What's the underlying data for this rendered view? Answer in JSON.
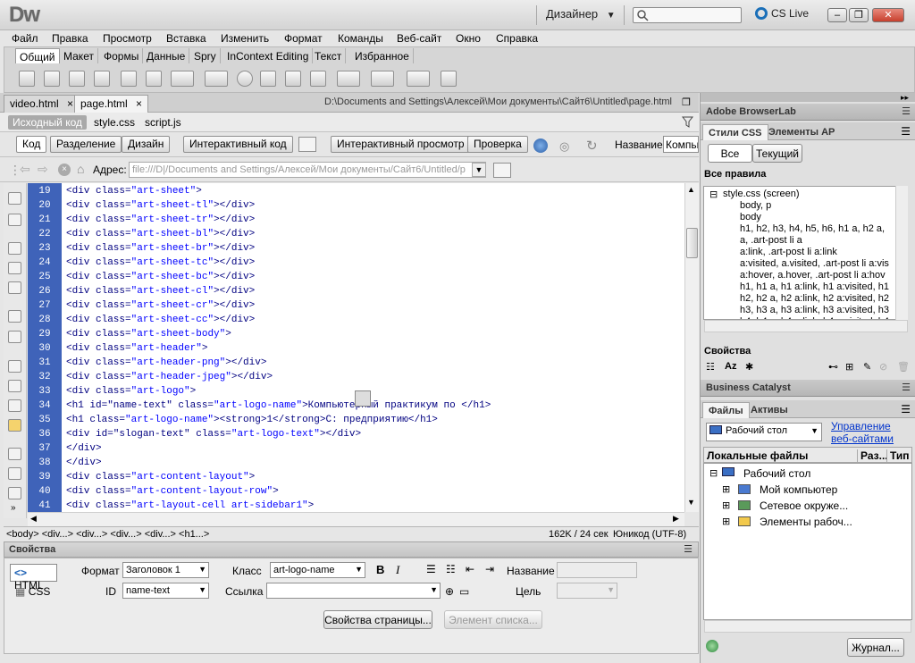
{
  "app": {
    "logo": "Dw",
    "workspace": "Дизайнер",
    "cslive": "CS Live",
    "close_label": "✕"
  },
  "menu": [
    "Файл",
    "Правка",
    "Просмотр",
    "Вставка",
    "Изменить",
    "Формат",
    "Команды",
    "Веб-сайт",
    "Окно",
    "Справка"
  ],
  "insert_tabs": [
    "Общий",
    "Макет",
    "Формы",
    "Данные",
    "Spry",
    "InContext Editing",
    "Текст",
    "Избранное"
  ],
  "doc_tabs": [
    "video.html",
    "page.html"
  ],
  "doc_path": "D:\\Documents and Settings\\Алексей\\Мои документы\\Сайт6\\Untitled\\page.html",
  "related_files": [
    "Исходный код",
    "style.css",
    "script.js"
  ],
  "doc_toolbar": {
    "code": "Код",
    "split": "Разделение",
    "design": "Дизайн",
    "live_code": "Интерактивный код",
    "live_view": "Интерактивный просмотр",
    "check": "Проверка",
    "title_label": "Название:",
    "title_value": "Компьют"
  },
  "address": {
    "label": "Адрес:",
    "value": "file:///D|/Documents and Settings/Алексей/Мои документы/Сайт6/Untitled/p"
  },
  "code_lines": [
    {
      "n": "19",
      "pre": "<div class=",
      "val": "\"art-sheet\"",
      "post": ">"
    },
    {
      "n": "20",
      "pre": "<div class=",
      "val": "\"art-sheet-tl\"",
      "post": "></div>"
    },
    {
      "n": "21",
      "pre": "<div class=",
      "val": "\"art-sheet-tr\"",
      "post": "></div>"
    },
    {
      "n": "22",
      "pre": "<div class=",
      "val": "\"art-sheet-bl\"",
      "post": "></div>"
    },
    {
      "n": "23",
      "pre": "<div class=",
      "val": "\"art-sheet-br\"",
      "post": "></div>"
    },
    {
      "n": "24",
      "pre": "<div class=",
      "val": "\"art-sheet-tc\"",
      "post": "></div>"
    },
    {
      "n": "25",
      "pre": "<div class=",
      "val": "\"art-sheet-bc\"",
      "post": "></div>"
    },
    {
      "n": "26",
      "pre": "<div class=",
      "val": "\"art-sheet-cl\"",
      "post": "></div>"
    },
    {
      "n": "27",
      "pre": "<div class=",
      "val": "\"art-sheet-cr\"",
      "post": "></div>"
    },
    {
      "n": "28",
      "pre": "<div class=",
      "val": "\"art-sheet-cc\"",
      "post": "></div>"
    },
    {
      "n": "29",
      "pre": "<div class=",
      "val": "\"art-sheet-body\"",
      "post": ">"
    },
    {
      "n": "30",
      "pre": "<div class=",
      "val": "\"art-header\"",
      "post": ">"
    },
    {
      "n": "31",
      "pre": "<div class=",
      "val": "\"art-header-png\"",
      "post": "></div>"
    },
    {
      "n": "32",
      "pre": "<div class=",
      "val": "\"art-header-jpeg\"",
      "post": "></div>"
    },
    {
      "n": "33",
      "pre": "<div class=",
      "val": "\"art-logo\"",
      "post": ">"
    },
    {
      "n": "34",
      "pre": "<h1 id=\"name-text\" class=",
      "val": "\"art-logo-name\"",
      "post": ">Компьютерный практикум по </h1>"
    },
    {
      "n": "35",
      "pre": "<h1 class=",
      "val": "\"art-logo-name\"",
      "post": "><strong>1</strong>С: предприятию</h1>"
    },
    {
      "n": "36",
      "pre": "<div id=\"slogan-text\" class=",
      "val": "\"art-logo-text\"",
      "post": "></div>"
    },
    {
      "n": "37",
      "pre": "</div>",
      "val": "",
      "post": ""
    },
    {
      "n": "38",
      "pre": "</div>",
      "val": "",
      "post": ""
    },
    {
      "n": "39",
      "pre": "<div class=",
      "val": "\"art-content-layout\"",
      "post": ">"
    },
    {
      "n": "40",
      "pre": "<div class=",
      "val": "\"art-content-layout-row\"",
      "post": ">"
    },
    {
      "n": "41",
      "pre": "<div class=",
      "val": "\"art-layout-cell art-sidebar1\"",
      "post": ">"
    }
  ],
  "status": {
    "tags": "<body> <div...> <div...> <div...> <div...> <h1...>",
    "size": "162K / 24 сек",
    "encoding": "Юникод (UTF-8)"
  },
  "properties": {
    "title": "Свойства",
    "html_btn": "HTML",
    "css_btn": "CSS",
    "format_label": "Формат",
    "format_value": "Заголовок 1",
    "class_label": "Класс",
    "class_value": "art-logo-name",
    "id_label": "ID",
    "id_value": "name-text",
    "link_label": "Ссылка",
    "link_value": "",
    "name_label": "Название",
    "target_label": "Цель",
    "page_props": "Свойства страницы...",
    "list_item": "Элемент списка..."
  },
  "right": {
    "browserlab": "Adobe BrowserLab",
    "css_tabs": [
      "Стили CSS",
      "Элементы AP"
    ],
    "css_modes": [
      "Все",
      "Текущий"
    ],
    "all_rules": "Все правила",
    "rules_root": "style.css (screen)",
    "rules": [
      "body, p",
      "body",
      "h1, h2, h3, h4, h5, h6, h1 a, h2 a,",
      "a, .art-post li a",
      "a:link, .art-post li a:link",
      "a:visited, a.visited, .art-post li a:vis",
      "a:hover, a.hover, .art-post li a:hov",
      "h1, h1 a, h1 a:link, h1 a:visited, h1",
      "h2, h2 a, h2 a:link, h2 a:visited, h2",
      "h3, h3 a, h3 a:link, h3 a:visited, h3",
      "h4, h4 a, h4 a:link, h4 a:visited, h4"
    ],
    "properties": "Свойства",
    "business_catalyst": "Business Catalyst",
    "files_tabs": [
      "Файлы",
      "Активы"
    ],
    "site_select": "Рабочий стол",
    "manage_sites": [
      "Управление",
      "веб-сайтами"
    ],
    "local_files": "Локальные файлы",
    "col_size": "Раз...",
    "col_type": "Тип",
    "tree_root": "Рабочий стол",
    "tree_items": [
      "Мой компьютер",
      "Сетевое окруже...",
      "Элементы рабоч..."
    ],
    "log_btn": "Журнал..."
  }
}
